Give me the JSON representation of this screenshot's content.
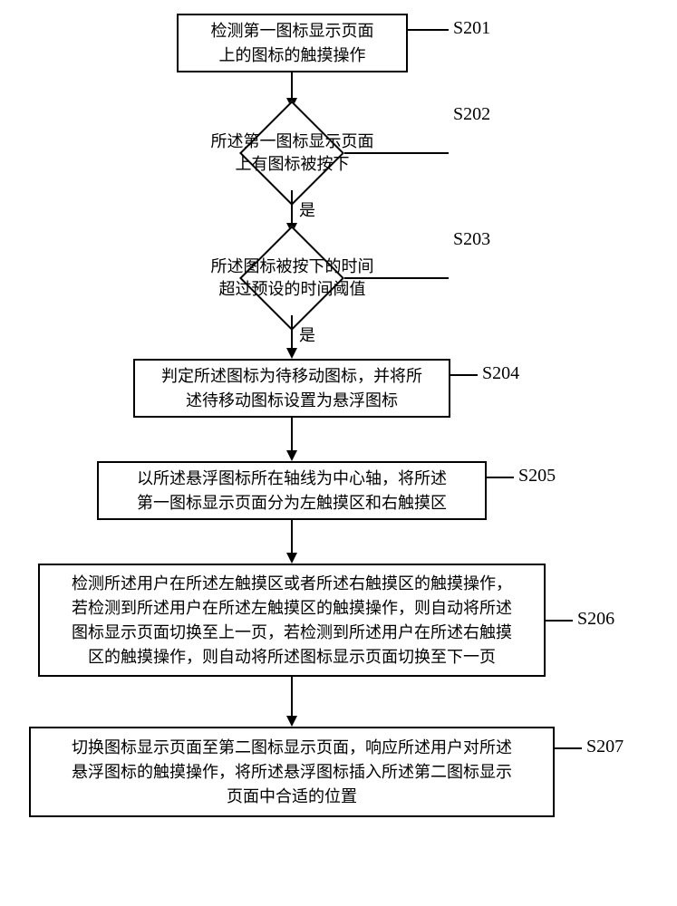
{
  "steps": {
    "s201": {
      "label": "S201",
      "text": "检测第一图标显示页面\n上的图标的触摸操作"
    },
    "s202": {
      "label": "S202",
      "text": "所述第一图标显示页面\n上有图标被按下"
    },
    "s203": {
      "label": "S203",
      "text": "所述图标被按下的时间\n超过预设的时间阈值"
    },
    "s204": {
      "label": "S204",
      "text": "判定所述图标为待移动图标，并将所\n述待移动图标设置为悬浮图标"
    },
    "s205": {
      "label": "S205",
      "text": "以所述悬浮图标所在轴线为中心轴，将所述\n第一图标显示页面分为左触摸区和右触摸区"
    },
    "s206": {
      "label": "S206",
      "text": "检测所述用户在所述左触摸区或者所述右触摸区的触摸操作，\n若检测到所述用户在所述左触摸区的触摸操作，则自动将所述\n图标显示页面切换至上一页，若检测到所述用户在所述右触摸\n区的触摸操作，则自动将所述图标显示页面切换至下一页"
    },
    "s207": {
      "label": "S207",
      "text": "切换图标显示页面至第二图标显示页面，响应所述用户对所述\n悬浮图标的触摸操作，将所述悬浮图标插入所述第二图标显示\n页面中合适的位置"
    }
  },
  "edges": {
    "yes": "是"
  },
  "chart_data": {
    "type": "flowchart",
    "nodes": [
      {
        "id": "S201",
        "shape": "process",
        "text": "检测第一图标显示页面上的图标的触摸操作"
      },
      {
        "id": "S202",
        "shape": "decision",
        "text": "所述第一图标显示页面上有图标被按下"
      },
      {
        "id": "S203",
        "shape": "decision",
        "text": "所述图标被按下的时间超过预设的时间阈值"
      },
      {
        "id": "S204",
        "shape": "process",
        "text": "判定所述图标为待移动图标，并将所述待移动图标设置为悬浮图标"
      },
      {
        "id": "S205",
        "shape": "process",
        "text": "以所述悬浮图标所在轴线为中心轴，将所述第一图标显示页面分为左触摸区和右触摸区"
      },
      {
        "id": "S206",
        "shape": "process",
        "text": "检测所述用户在所述左触摸区或者所述右触摸区的触摸操作，若检测到所述用户在所述左触摸区的触摸操作，则自动将所述图标显示页面切换至上一页，若检测到所述用户在所述右触摸区的触摸操作，则自动将所述图标显示页面切换至下一页"
      },
      {
        "id": "S207",
        "shape": "process",
        "text": "切换图标显示页面至第二图标显示页面，响应所述用户对所述悬浮图标的触摸操作，将所述悬浮图标插入所述第二图标显示页面中合适的位置"
      }
    ],
    "edges": [
      {
        "from": "S201",
        "to": "S202"
      },
      {
        "from": "S202",
        "to": "S203",
        "label": "是"
      },
      {
        "from": "S203",
        "to": "S204",
        "label": "是"
      },
      {
        "from": "S204",
        "to": "S205"
      },
      {
        "from": "S205",
        "to": "S206"
      },
      {
        "from": "S206",
        "to": "S207"
      }
    ]
  }
}
